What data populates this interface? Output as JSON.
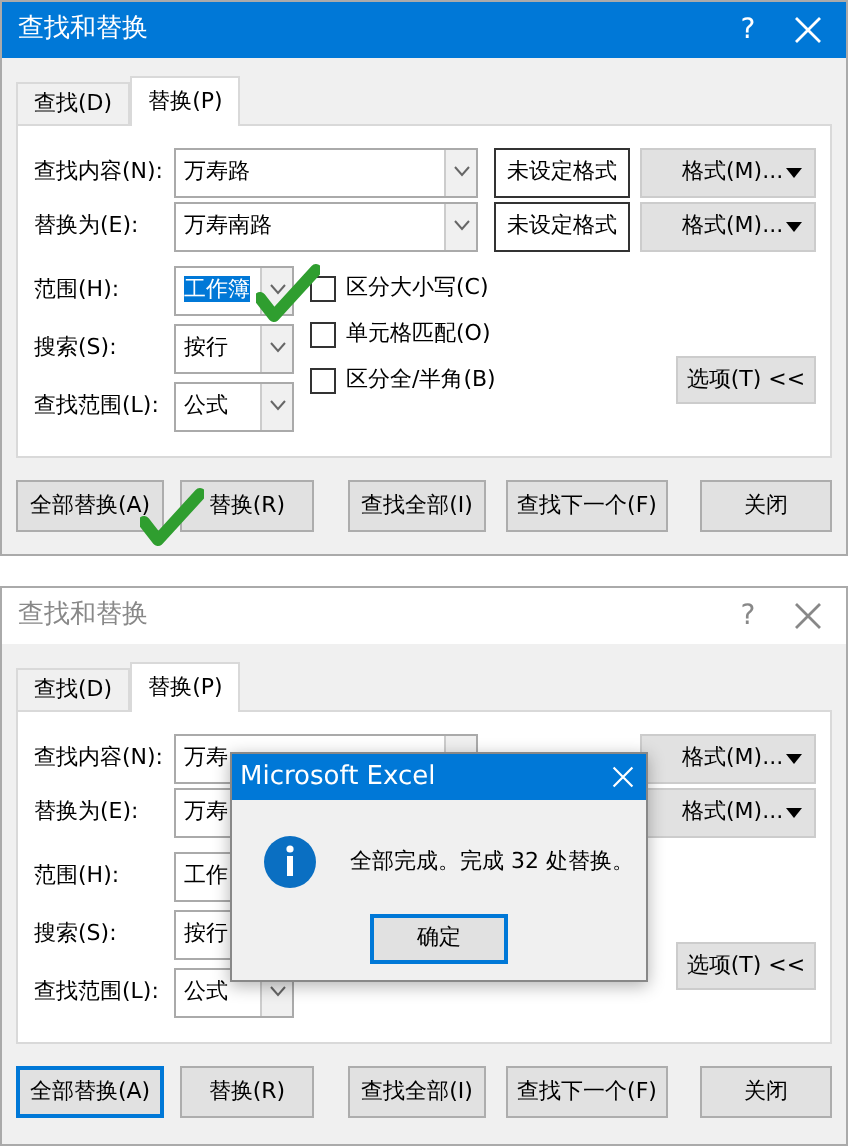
{
  "dialogs": [
    {
      "title": "查找和替换",
      "active": true,
      "help": "?",
      "tabs": [
        {
          "label": "查找(D)",
          "selected": false
        },
        {
          "label": "替换(P)",
          "selected": true
        }
      ],
      "fields": [
        {
          "label": "查找内容(N):",
          "value": "万寿路",
          "dropdown": true,
          "format_preview": "未设定格式",
          "format_button": "格式(M)..."
        },
        {
          "label": "替换为(E):",
          "value": "万寿南路",
          "dropdown": true,
          "format_preview": "未设定格式",
          "format_button": "格式(M)..."
        }
      ],
      "options": [
        {
          "label": "范围(H):",
          "value": "工作簿",
          "highlighted": true,
          "dropdown": true
        },
        {
          "label": "搜索(S):",
          "value": "按行",
          "highlighted": false,
          "dropdown": true
        },
        {
          "label": "查找范围(L):",
          "value": "公式",
          "highlighted": false,
          "dropdown": true
        }
      ],
      "checkboxes": [
        {
          "label": "区分大小写(C)",
          "checked": false
        },
        {
          "label": "单元格匹配(O)",
          "checked": false
        },
        {
          "label": "区分全/半角(B)",
          "checked": false
        }
      ],
      "options_button": "选项(T) <<",
      "buttons": [
        {
          "label": "全部替换(A)",
          "focused": false
        },
        {
          "label": "替换(R)",
          "focused": false
        },
        {
          "label": "查找全部(I)",
          "focused": false
        },
        {
          "label": "查找下一个(F)",
          "focused": false
        },
        {
          "label": "关闭",
          "focused": false
        }
      ],
      "annotations": [
        {
          "kind": "check"
        },
        {
          "kind": "check"
        }
      ]
    },
    {
      "title": "查找和替换",
      "active": false,
      "help": "?",
      "tabs": [
        {
          "label": "查找(D)",
          "selected": false
        },
        {
          "label": "替换(P)",
          "selected": true
        }
      ],
      "fields": [
        {
          "label": "查找内容(N):",
          "value": "万寿",
          "dropdown": true,
          "format_button": "格式(M)..."
        },
        {
          "label": "替换为(E):",
          "value": "万寿",
          "format_button": "格式(M)..."
        }
      ],
      "options": [
        {
          "label": "范围(H):",
          "value": "工作",
          "highlighted": false
        },
        {
          "label": "搜索(S):",
          "value": "按行",
          "highlighted": false
        },
        {
          "label": "查找范围(L):",
          "value": "公式",
          "highlighted": false,
          "dropdown": true
        }
      ],
      "options_button": "选项(T) <<",
      "buttons": [
        {
          "label": "全部替换(A)",
          "focused": true
        },
        {
          "label": "替换(R)",
          "focused": false
        },
        {
          "label": "查找全部(I)",
          "focused": false
        },
        {
          "label": "查找下一个(F)",
          "focused": false
        },
        {
          "label": "关闭",
          "focused": false
        }
      ],
      "message_box": {
        "title": "Microsoft Excel",
        "text": "全部完成。完成 32 处替换。",
        "button": "确定"
      }
    }
  ]
}
